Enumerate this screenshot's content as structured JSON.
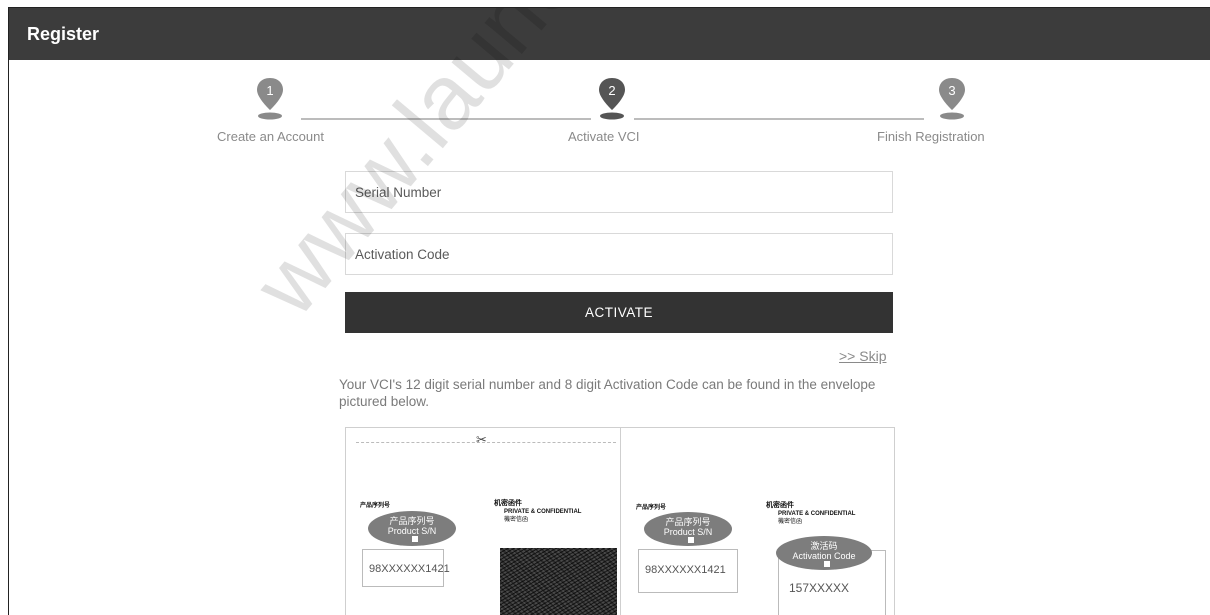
{
  "header": {
    "title": "Register"
  },
  "steps": [
    {
      "number": "1",
      "label": "Create an Account"
    },
    {
      "number": "2",
      "label": "Activate VCI"
    },
    {
      "number": "3",
      "label": "Finish Registration"
    }
  ],
  "form": {
    "serial_placeholder": "Serial Number",
    "activation_placeholder": "Activation Code",
    "activate_label": "ACTIVATE",
    "skip_label": ">> Skip"
  },
  "info_text": "Your VCI's 12 digit serial number and 8 digit Activation Code can be found in the envelope pictured below.",
  "envelope": {
    "scissors": "✂",
    "left": {
      "product_cn": "产品序列号",
      "bubble_cn": "产品序列号",
      "bubble_en": "Product S/N",
      "serial": "98XXXXXX1421",
      "conf_cn": "机密函件",
      "conf_en": "PRIVATE & CONFIDENTIAL",
      "conf_sub": "機密信函"
    },
    "right": {
      "product_cn": "产品序列号",
      "bubble_cn": "产品序列号",
      "bubble_en": "Product S/N",
      "serial": "98XXXXXX1421",
      "conf_cn": "机密函件",
      "conf_en": "PRIVATE & CONFIDENTIAL",
      "conf_sub": "機密信函",
      "act_bubble_cn": "激活码",
      "act_bubble_en": "Activation Code",
      "act_code": "157XXXXX"
    }
  },
  "watermark": "www.launch-cis.",
  "colors": {
    "header_bg": "#3c3c3c",
    "button_bg": "#333333",
    "pin_active": "#555555",
    "pin_inactive": "#8a8a8a"
  }
}
